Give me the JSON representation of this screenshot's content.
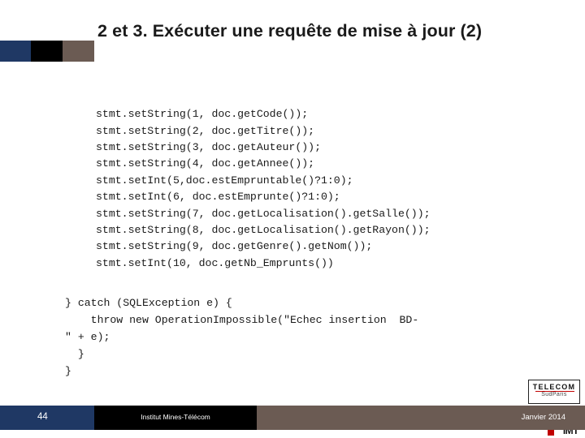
{
  "slide": {
    "title": "2 et 3. Exécuter une requête de mise à jour (2)",
    "code_main": "stmt.setString(1, doc.getCode());\nstmt.setString(2, doc.getTitre());\nstmt.setString(3, doc.getAuteur());\nstmt.setString(4, doc.getAnnee());\nstmt.setInt(5,doc.estEmpruntable()?1:0);\nstmt.setInt(6, doc.estEmprunte()?1:0);\nstmt.setString(7, doc.getLocalisation().getSalle());\nstmt.setString(8, doc.getLocalisation().getRayon());\nstmt.setString(9, doc.getGenre().getNom());\nstmt.setInt(10, doc.getNb_Emprunts())",
    "code_catch": "} catch (SQLException e) {\n    throw new OperationImpossible(\"Echec insertion  BD-\n\" + e);\n  }\n}"
  },
  "footer": {
    "slide_number": "44",
    "institution": "Institut Mines-Télécom",
    "date": "Janvier 2014"
  },
  "logo": {
    "top_text": "TELECOM",
    "bottom_text": "SudParis",
    "mark_text": "IMT"
  },
  "colors": {
    "accent_blue": "#1F3864",
    "accent_black": "#000000",
    "accent_brown": "#6B5B53",
    "logo_red": "#C00000"
  }
}
